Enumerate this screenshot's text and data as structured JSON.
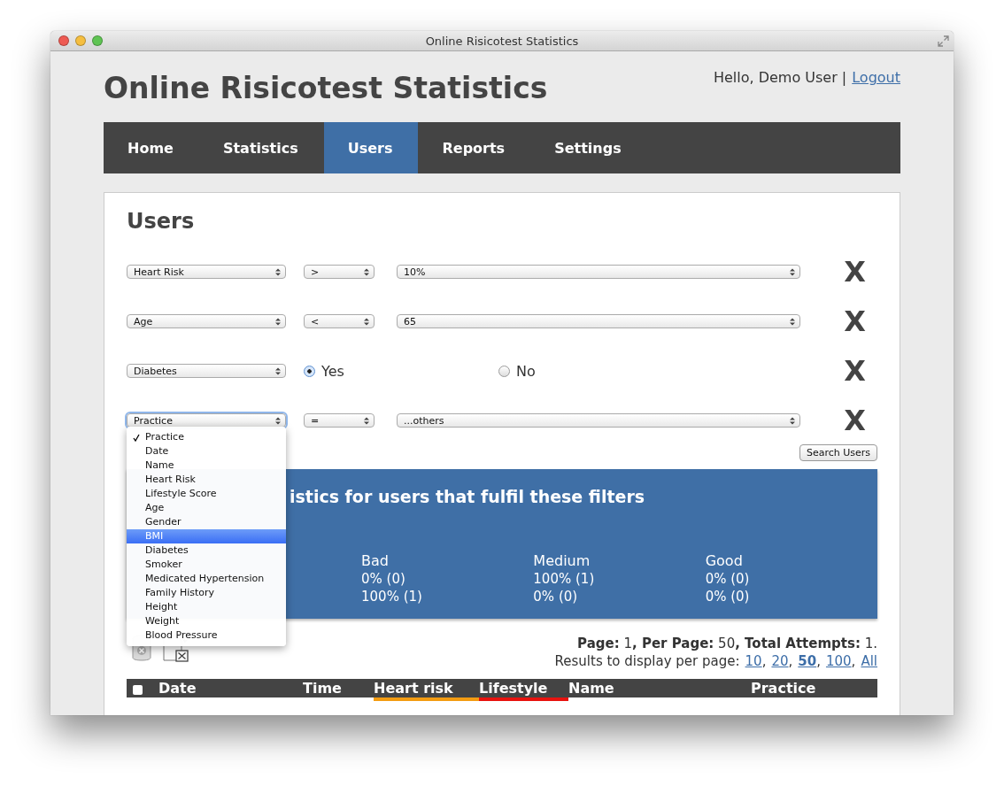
{
  "window": {
    "title": "Online Risicotest Statistics"
  },
  "header": {
    "title": "Online Risicotest Statistics",
    "greeting": "Hello, Demo User |",
    "logout": "Logout"
  },
  "nav": [
    {
      "label": "Home",
      "selected": false
    },
    {
      "label": "Statistics",
      "selected": false
    },
    {
      "label": "Users",
      "selected": true
    },
    {
      "label": "Reports",
      "selected": false
    },
    {
      "label": "Settings",
      "selected": false
    }
  ],
  "page_title": "Users",
  "filters": [
    {
      "kind": "select",
      "field": "Heart Risk",
      "operator": ">",
      "value": "10%",
      "focused": false,
      "remove": "X"
    },
    {
      "kind": "select",
      "field": "Age",
      "operator": "<",
      "value": "65",
      "focused": false,
      "remove": "X"
    },
    {
      "kind": "radio",
      "field": "Diabetes",
      "focused": false,
      "options": [
        {
          "label": "Yes",
          "selected": true
        },
        {
          "label": "No",
          "selected": false
        }
      ],
      "remove": "X"
    },
    {
      "kind": "select",
      "field": "Practice",
      "operator": "=",
      "value": "...others",
      "focused": true,
      "remove": "X"
    }
  ],
  "field_menu": {
    "items": [
      {
        "label": "Practice",
        "checked": true,
        "highlighted": false
      },
      {
        "label": "Date",
        "checked": false,
        "highlighted": false
      },
      {
        "label": "Name",
        "checked": false,
        "highlighted": false
      },
      {
        "label": "Heart Risk",
        "checked": false,
        "highlighted": false
      },
      {
        "label": "Lifestyle Score",
        "checked": false,
        "highlighted": false
      },
      {
        "label": "Age",
        "checked": false,
        "highlighted": false
      },
      {
        "label": "Gender",
        "checked": false,
        "highlighted": false
      },
      {
        "label": "BMI",
        "checked": false,
        "highlighted": true
      },
      {
        "label": "Diabetes",
        "checked": false,
        "highlighted": false
      },
      {
        "label": "Smoker",
        "checked": false,
        "highlighted": false
      },
      {
        "label": "Medicated Hypertension",
        "checked": false,
        "highlighted": false
      },
      {
        "label": "Family History",
        "checked": false,
        "highlighted": false
      },
      {
        "label": "Height",
        "checked": false,
        "highlighted": false
      },
      {
        "label": "Weight",
        "checked": false,
        "highlighted": false
      },
      {
        "label": "Blood Pressure",
        "checked": false,
        "highlighted": false
      }
    ]
  },
  "search_button": "Search Users",
  "stats": {
    "title": "istics for users that fulfil these filters",
    "columns": [
      {
        "heading": "Bad",
        "values": [
          "0% (0)",
          "100% (1)"
        ]
      },
      {
        "heading": "Medium",
        "values": [
          "100% (1)",
          "0% (0)"
        ]
      },
      {
        "heading": "Good",
        "values": [
          "0% (0)",
          "0% (0)"
        ]
      }
    ]
  },
  "pagination": {
    "summary": "**Page:** 1**, Per Page:** 50**, Total Attempts:** 1.",
    "per_page_label": "Results to display per page:",
    "separator": ",",
    "options": [
      {
        "label": "10",
        "selected": false
      },
      {
        "label": "20",
        "selected": false
      },
      {
        "label": "50",
        "selected": true
      },
      {
        "label": "100",
        "selected": false
      },
      {
        "label": "All",
        "selected": false
      }
    ]
  },
  "table": {
    "select_all_checked": false,
    "columns": [
      {
        "label": "Date"
      },
      {
        "label": "Time"
      },
      {
        "label": "Heart risk",
        "color": "#f39c12"
      },
      {
        "label": "Lifestyle",
        "color": "#e8130f"
      },
      {
        "label": "Name"
      },
      {
        "label": "Practice"
      }
    ]
  }
}
